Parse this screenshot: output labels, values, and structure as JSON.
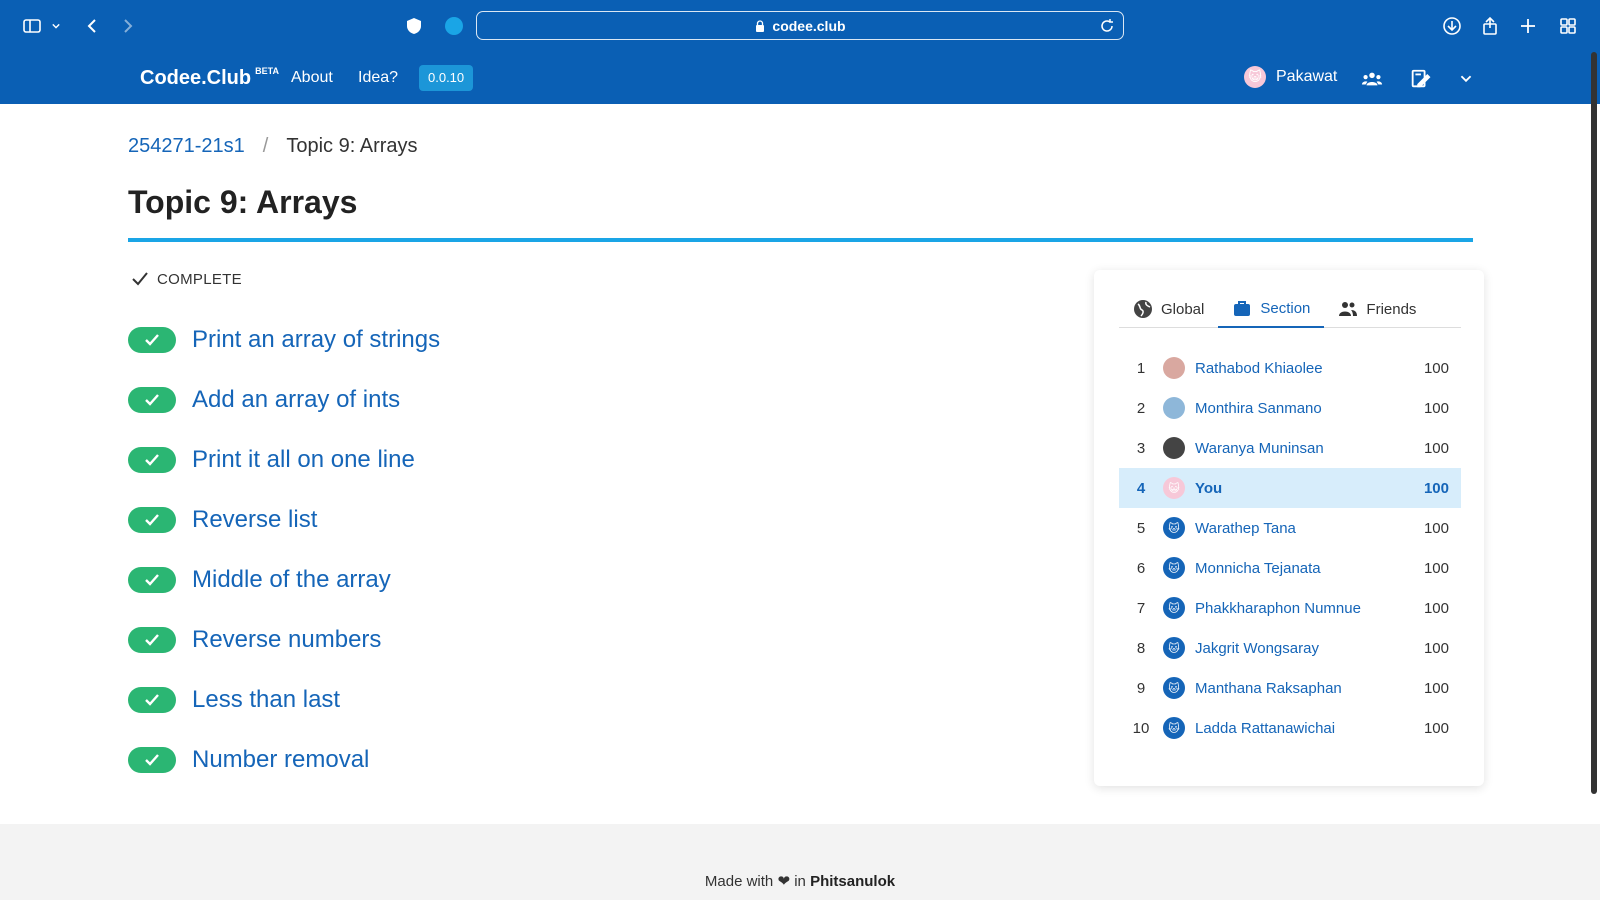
{
  "browser": {
    "url": "codee.club"
  },
  "nav": {
    "brand": "Codee.Club",
    "brand_badge": "BETA",
    "links": [
      "About",
      "Idea?"
    ],
    "version": "0.0.10",
    "user_name": "Pakawat"
  },
  "breadcrumb": {
    "course": "254271-21s1",
    "separator": "/",
    "current": "Topic 9: Arrays"
  },
  "page": {
    "title": "Topic 9: Arrays",
    "status": "COMPLETE"
  },
  "problems": [
    "Print an array of strings",
    "Add an array of ints",
    "Print it all on one line",
    "Reverse list",
    "Middle of the array",
    "Reverse numbers",
    "Less than last",
    "Number removal"
  ],
  "leaderboard": {
    "tabs": [
      "Global",
      "Section",
      "Friends"
    ],
    "active_tab": "Section",
    "rows": [
      {
        "rank": "1",
        "name": "Rathabod Khiaolee",
        "score": "100"
      },
      {
        "rank": "2",
        "name": "Monthira Sanmano",
        "score": "100"
      },
      {
        "rank": "3",
        "name": "Waranya Muninsan",
        "score": "100"
      },
      {
        "rank": "4",
        "name": "You",
        "score": "100"
      },
      {
        "rank": "5",
        "name": "Warathep Tana",
        "score": "100"
      },
      {
        "rank": "6",
        "name": "Monnicha Tejanata",
        "score": "100"
      },
      {
        "rank": "7",
        "name": "Phakkharaphon Numnue",
        "score": "100"
      },
      {
        "rank": "8",
        "name": "Jakgrit Wongsaray",
        "score": "100"
      },
      {
        "rank": "9",
        "name": "Manthana Raksaphan",
        "score": "100"
      },
      {
        "rank": "10",
        "name": "Ladda Rattanawichai",
        "score": "100"
      }
    ]
  },
  "footer": {
    "prefix": "Made with",
    "middle": "in",
    "place": "Phitsanulok"
  },
  "colors": {
    "primary": "#0a5fb4",
    "link": "#1565b8",
    "success": "#2bb673",
    "accent": "#1aa5e6",
    "highlight_row": "#d7edfb"
  }
}
